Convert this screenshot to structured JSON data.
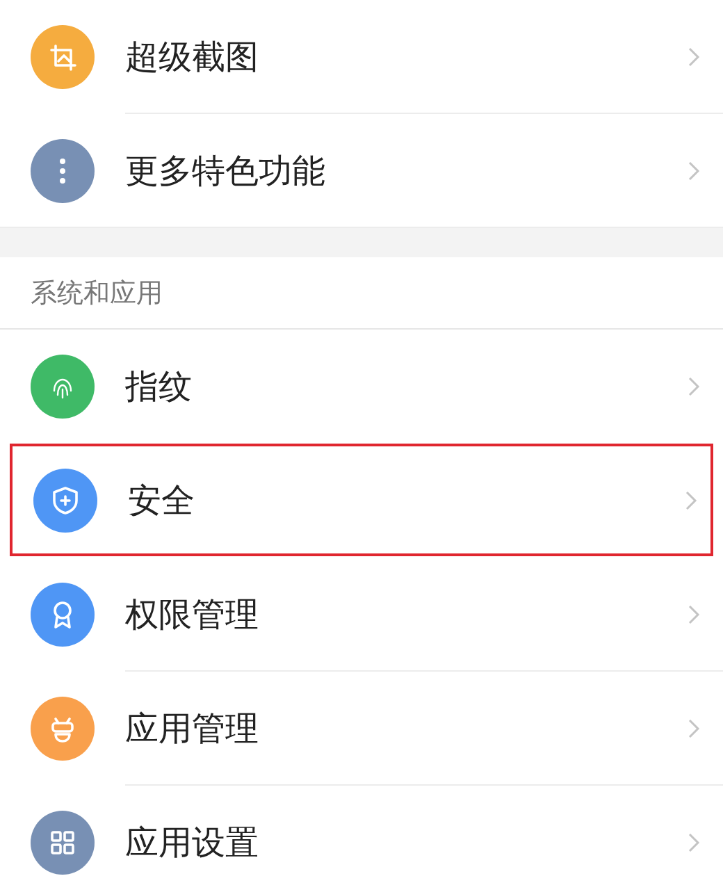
{
  "sections": [
    {
      "items": [
        {
          "label": "超级截图",
          "kind": "crop",
          "color": "#f5ac3f",
          "highlighted": false
        },
        {
          "label": "更多特色功能",
          "kind": "more",
          "color": "#7890b4",
          "highlighted": false
        }
      ]
    },
    {
      "header": "系统和应用",
      "items": [
        {
          "label": "指纹",
          "kind": "fingerprint",
          "color": "#3fba67",
          "highlighted": false
        },
        {
          "label": "安全",
          "kind": "shield",
          "color": "#4f96f5",
          "highlighted": true
        },
        {
          "label": "权限管理",
          "kind": "badge",
          "color": "#4f96f5",
          "highlighted": false
        },
        {
          "label": "应用管理",
          "kind": "robot",
          "color": "#f9a04c",
          "highlighted": false
        },
        {
          "label": "应用设置",
          "kind": "grid",
          "color": "#7890b4",
          "highlighted": false
        }
      ]
    }
  ]
}
